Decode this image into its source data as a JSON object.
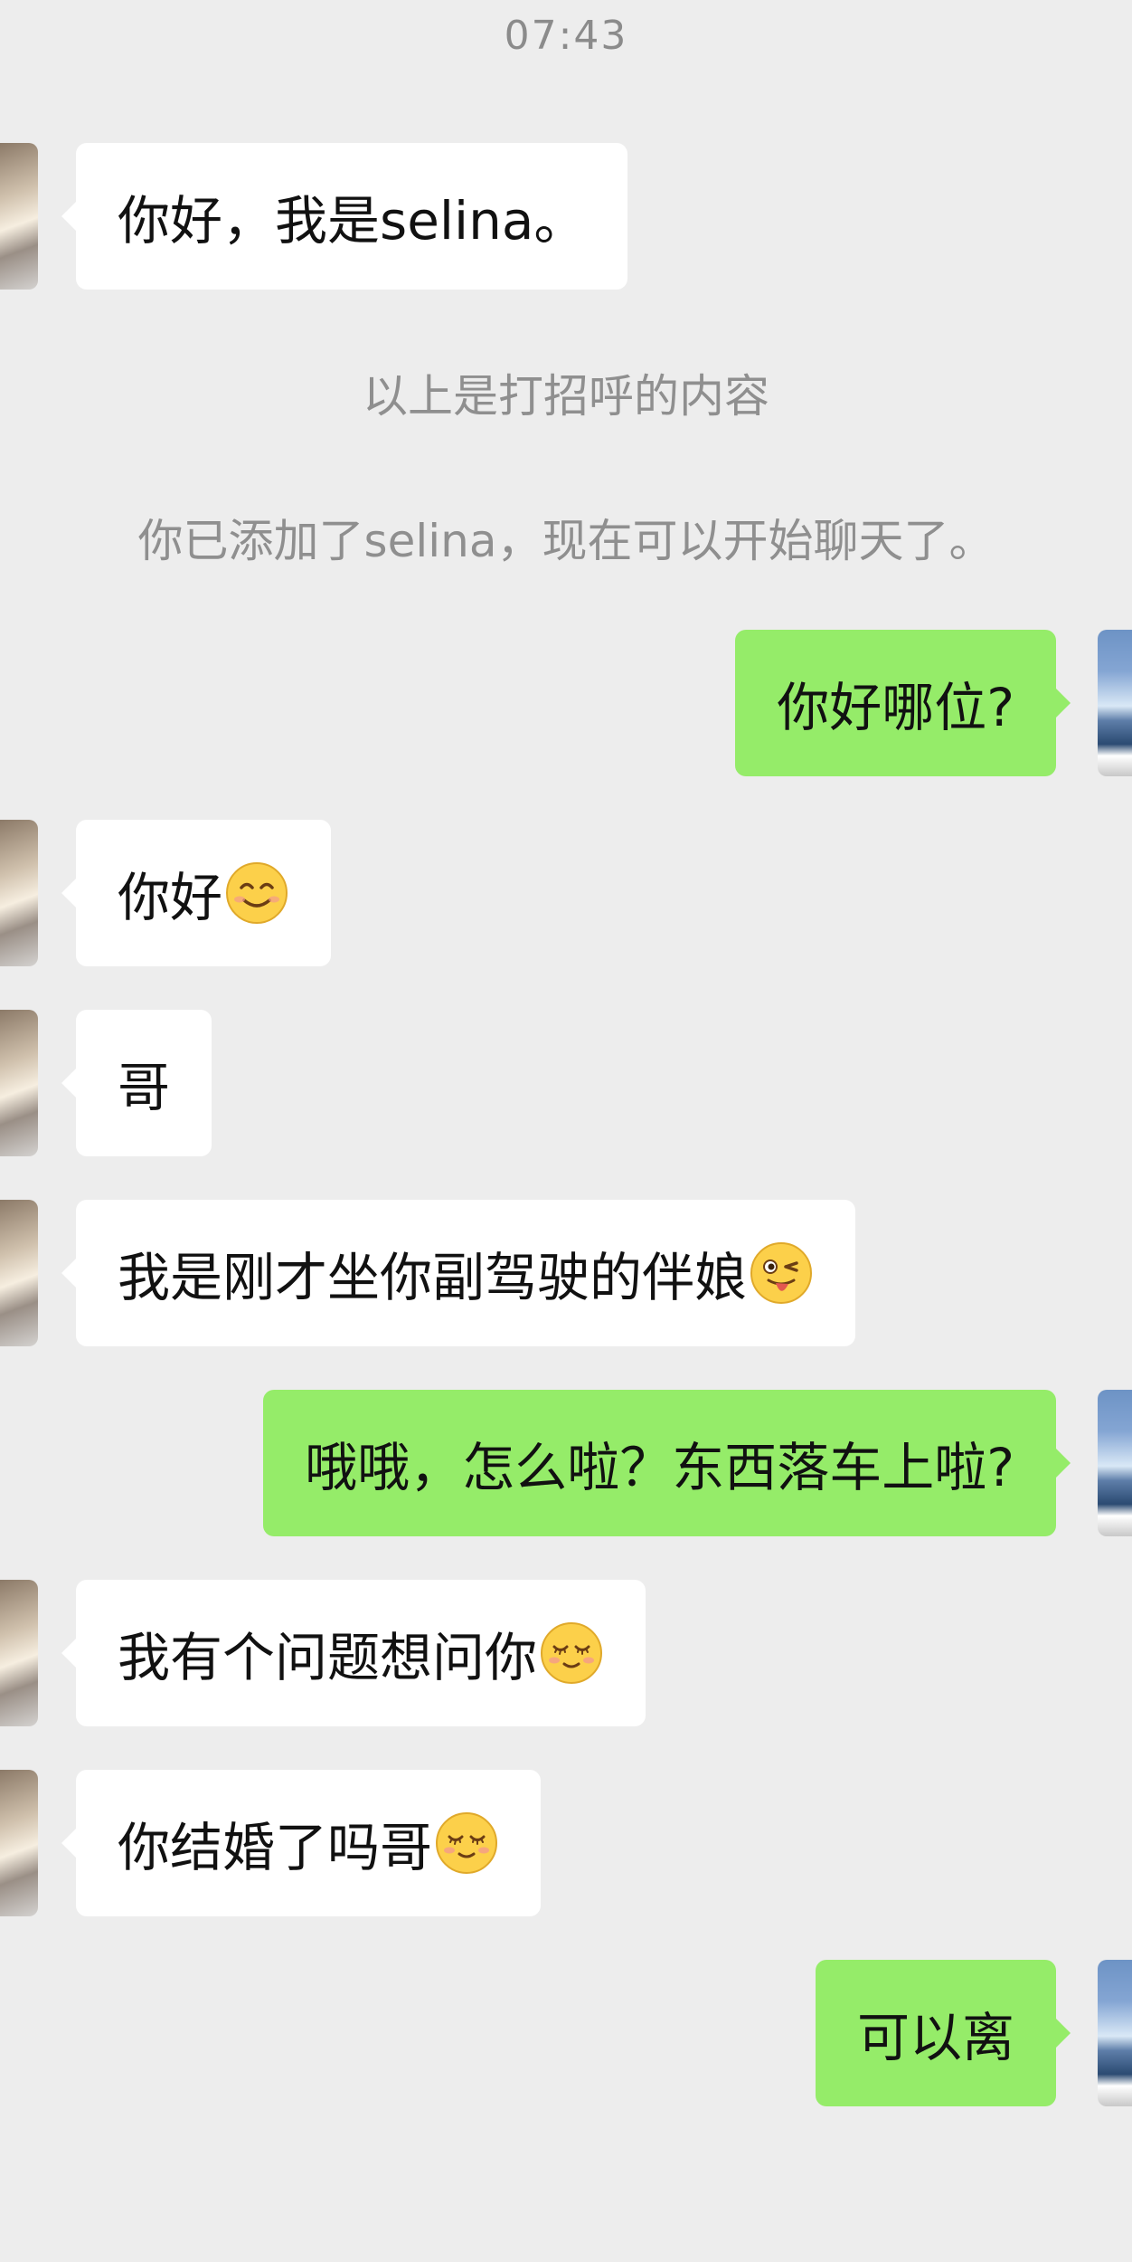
{
  "chat": {
    "timestamp": "07:43",
    "system_notes": [
      "以上是打招呼的内容",
      "你已添加了selina，现在可以开始聊天了。"
    ],
    "messages": [
      {
        "side": "in",
        "text": "你好，我是selina。",
        "emoji": null
      },
      {
        "side": "out",
        "text": "你好哪位?",
        "emoji": null
      },
      {
        "side": "in",
        "text": "你好",
        "emoji": "smile-emoji"
      },
      {
        "side": "in",
        "text": "哥",
        "emoji": null
      },
      {
        "side": "in",
        "text": "我是刚才坐你副驾驶的伴娘",
        "emoji": "wink-tongue-emoji"
      },
      {
        "side": "out",
        "text": "哦哦，怎么啦？东西落车上啦?",
        "emoji": null
      },
      {
        "side": "in",
        "text": "我有个问题想问你",
        "emoji": "shy-emoji"
      },
      {
        "side": "in",
        "text": "你结婚了吗哥",
        "emoji": "shy-emoji"
      },
      {
        "side": "out",
        "text": "可以离",
        "emoji": null
      }
    ]
  },
  "colors": {
    "background": "#ededed",
    "incoming_bubble": "#ffffff",
    "outgoing_bubble": "#95ec69",
    "system_text": "#8f8f8f"
  }
}
